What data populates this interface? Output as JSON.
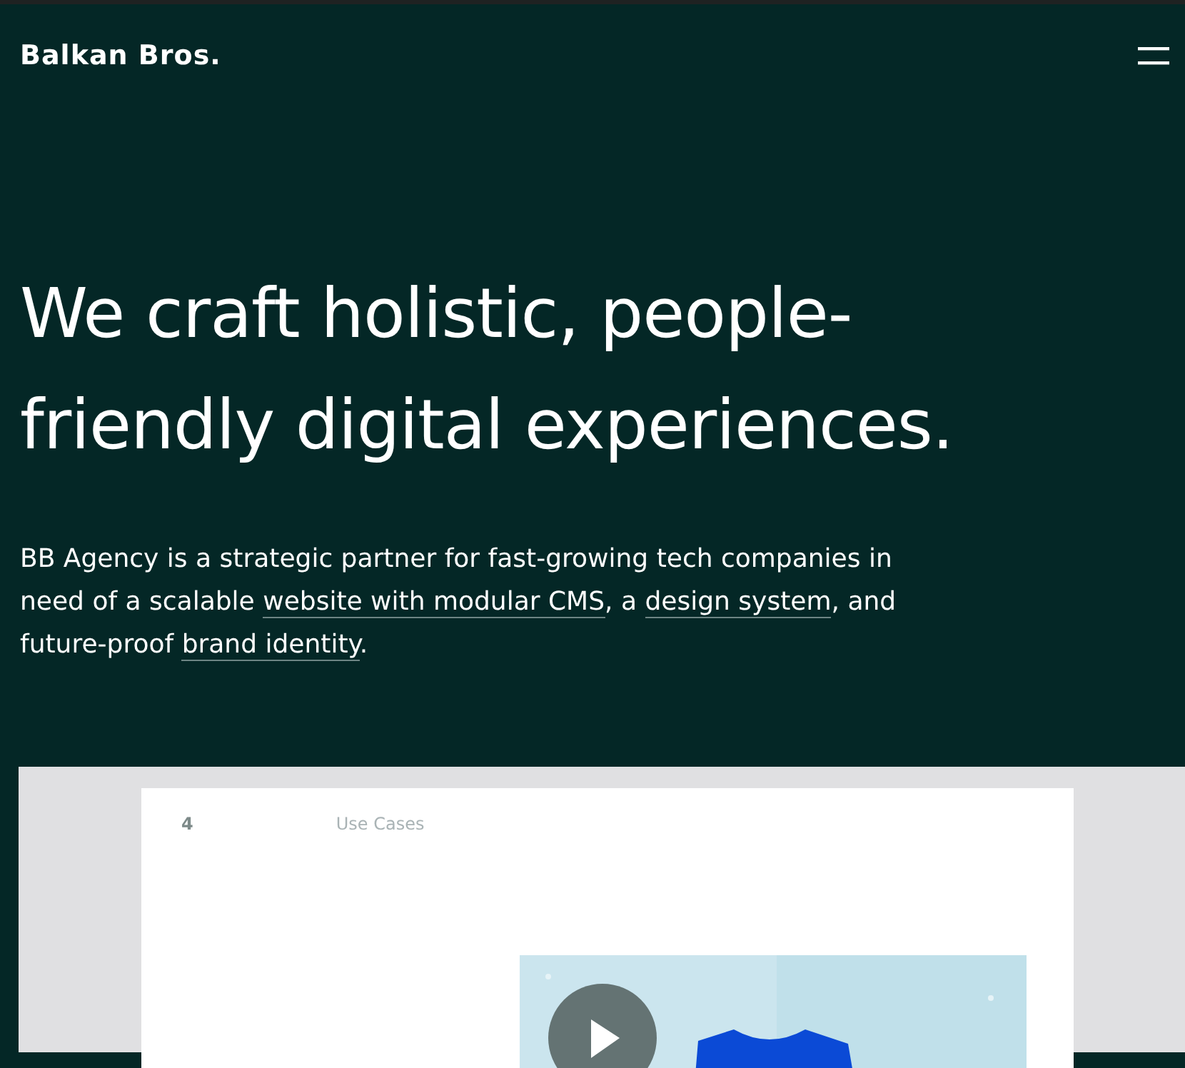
{
  "header": {
    "logo": "Balkan Bros."
  },
  "hero": {
    "headline": "We craft holistic, people-friendly digital experiences.",
    "intro": [
      {
        "kind": "text",
        "text": "BB Agency is a strategic partner for fast-growing tech companies in need of a scalable "
      },
      {
        "kind": "link",
        "text": "website with modular CMS"
      },
      {
        "kind": "text",
        "text": ", a "
      },
      {
        "kind": "link",
        "text": "design system"
      },
      {
        "kind": "text",
        "text": ", and future-proof "
      },
      {
        "kind": "link",
        "text": "brand identity"
      },
      {
        "kind": "text",
        "text": "."
      }
    ]
  },
  "showcase": {
    "number": "4",
    "label": "Use Cases"
  }
}
